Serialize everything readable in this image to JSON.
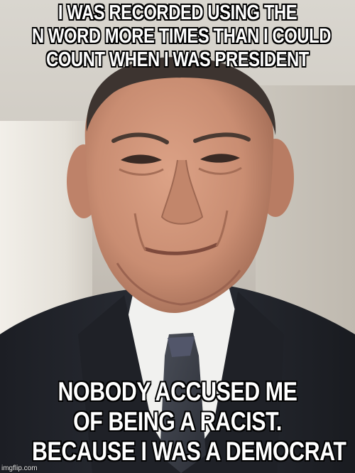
{
  "meme": {
    "top_text": [
      "I WAS RECORDED USING THE",
      "N WORD MORE TIMES THAN I COULD",
      "COUNT WHEN I WAS PRESIDENT"
    ],
    "bottom_text": [
      "NOBODY ACCUSED ME",
      "OF BEING A RACIST.",
      "BECAUSE I WAS A DEMOCRAT"
    ],
    "watermark": "imgflip.com"
  },
  "colors": {
    "caption_fill": "#ffffff",
    "caption_outline": "#000000",
    "suit": "#23252c",
    "shirt": "#f1f1ef",
    "tie": "#3b3f48",
    "skin": "#c98d72"
  }
}
